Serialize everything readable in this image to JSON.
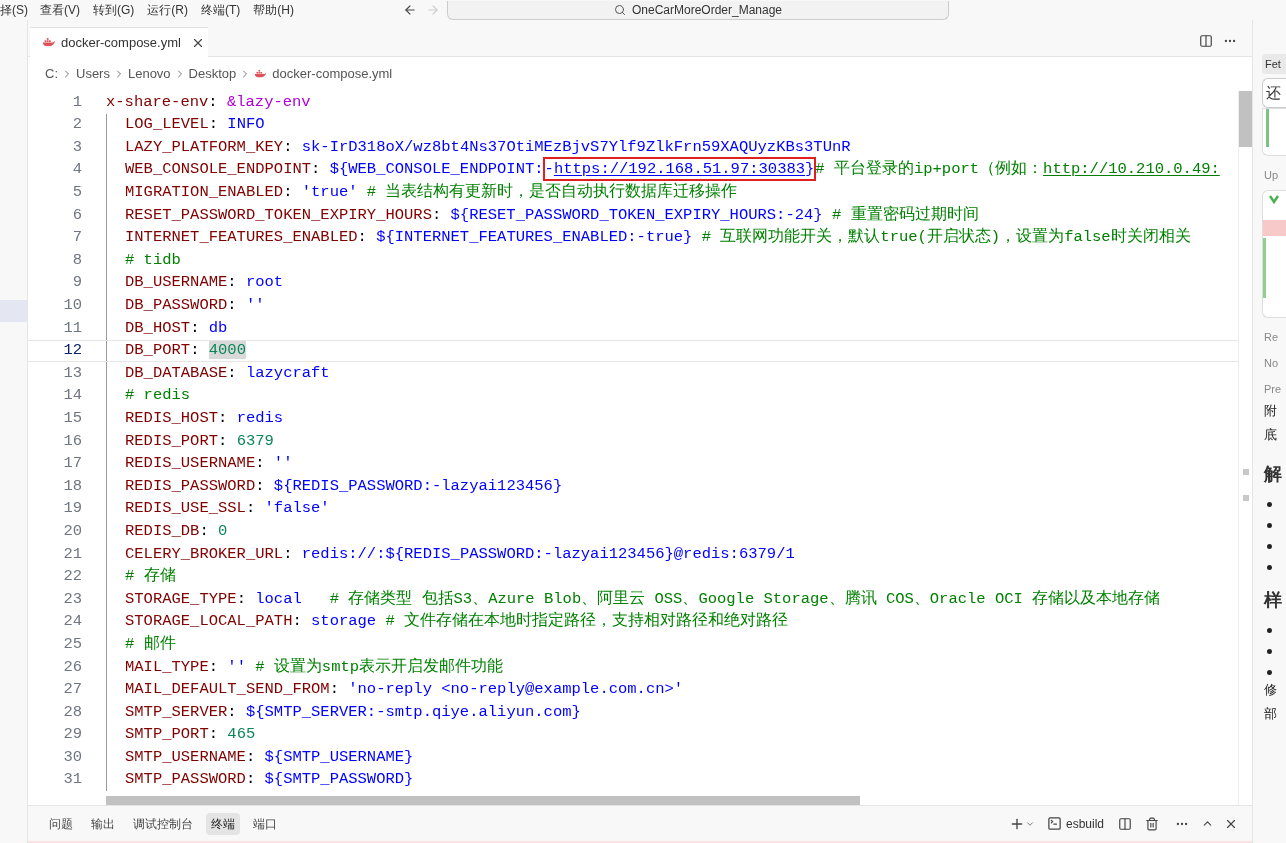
{
  "menu_bar": {
    "items": [
      "择(S)",
      "查看(V)",
      "转到(G)",
      "运行(R)",
      "终端(T)",
      "帮助(H)"
    ]
  },
  "command_center": {
    "search": "OneCarMoreOrder_Manage",
    "forward_disabled": true
  },
  "editor": {
    "tabs": [
      {
        "label": "docker-compose.yml",
        "selected": true
      }
    ],
    "breadcrumb": [
      "C:",
      "Users",
      "Lenovo",
      "Desktop",
      "docker-compose.yml"
    ],
    "lines": [
      {
        "number": "1",
        "current": false,
        "tokens": [
          {
            "kind": "key",
            "text": "x-share-env"
          },
          {
            "kind": "punct",
            "text": ": "
          },
          {
            "kind": "anchor",
            "text": "&lazy-env"
          }
        ],
        "children": [
          {
            "number": "2",
            "current": false,
            "tokens": [
              {
                "kind": "key",
                "text": "LOG_LEVEL"
              },
              {
                "kind": "punct",
                "text": ": "
              },
              {
                "kind": "value",
                "text": "INFO"
              }
            ]
          },
          {
            "number": "3",
            "current": false,
            "tokens": [
              {
                "kind": "key",
                "text": "LAZY_PLATFORM_KEY"
              },
              {
                "kind": "punct",
                "text": ": "
              },
              {
                "kind": "value",
                "text": "sk-IrD318oX/wz8bt4Ns37OtiMEzBjvS7Ylf9ZlkFrn59XAQUyzKBs3TUnR"
              }
            ]
          },
          {
            "number": "4",
            "current": false,
            "tokens": [
              {
                "kind": "key",
                "text": "WEB_CONSOLE_ENDPOINT"
              },
              {
                "kind": "punct",
                "text": ": "
              },
              {
                "kind": "value",
                "text": "${WEB_CONSOLE_ENDPOINT:"
              },
              {
                "kind": "boxed",
                "parts": [
                  {
                    "kind": "value",
                    "text": "-"
                  },
                  {
                    "kind": "link",
                    "text": "https://192.168.51.97:30383"
                  },
                  {
                    "kind": "value",
                    "text": "}"
                  }
                ]
              },
              {
                "kind": "comment",
                "text": "# 平台登录的ip+port（例如："
              },
              {
                "kind": "comment_link",
                "text": "http://10.210.0.49:"
              }
            ]
          },
          {
            "number": "5",
            "current": false,
            "tokens": [
              {
                "kind": "key",
                "text": "MIGRATION_ENABLED"
              },
              {
                "kind": "punct",
                "text": ": "
              },
              {
                "kind": "value",
                "text": "'true'"
              },
              {
                "kind": "comment",
                "text": " # 当表结构有更新时，是否自动执行数据库迁移操作"
              }
            ]
          },
          {
            "number": "6",
            "current": false,
            "tokens": [
              {
                "kind": "key",
                "text": "RESET_PASSWORD_TOKEN_EXPIRY_HOURS"
              },
              {
                "kind": "punct",
                "text": ": "
              },
              {
                "kind": "value",
                "text": "${RESET_PASSWORD_TOKEN_EXPIRY_HOURS:-24}"
              },
              {
                "kind": "comment",
                "text": " # 重置密码过期时间"
              }
            ]
          },
          {
            "number": "7",
            "current": false,
            "tokens": [
              {
                "kind": "key",
                "text": "INTERNET_FEATURES_ENABLED"
              },
              {
                "kind": "punct",
                "text": ": "
              },
              {
                "kind": "value",
                "text": "${INTERNET_FEATURES_ENABLED:-true}"
              },
              {
                "kind": "comment",
                "text": " # 互联网功能开关，默认true(开启状态)，设置为false时关闭相关"
              }
            ]
          },
          {
            "number": "8",
            "current": false,
            "tokens": [
              {
                "kind": "comment",
                "text": "# tidb"
              }
            ]
          },
          {
            "number": "9",
            "current": false,
            "tokens": [
              {
                "kind": "key",
                "text": "DB_USERNAME"
              },
              {
                "kind": "punct",
                "text": ": "
              },
              {
                "kind": "value",
                "text": "root"
              }
            ]
          },
          {
            "number": "10",
            "current": false,
            "tokens": [
              {
                "kind": "key",
                "text": "DB_PASSWORD"
              },
              {
                "kind": "punct",
                "text": ": "
              },
              {
                "kind": "value",
                "text": "''"
              }
            ]
          },
          {
            "number": "11",
            "current": false,
            "tokens": [
              {
                "kind": "key",
                "text": "DB_HOST"
              },
              {
                "kind": "punct",
                "text": ": "
              },
              {
                "kind": "value",
                "text": "db"
              }
            ]
          },
          {
            "number": "12",
            "current": true,
            "tokens": [
              {
                "kind": "key",
                "text": "DB_PORT"
              },
              {
                "kind": "punct",
                "text": ": "
              },
              {
                "kind": "match",
                "text": "4000"
              }
            ]
          },
          {
            "number": "13",
            "current": false,
            "tokens": [
              {
                "kind": "key",
                "text": "DB_DATABASE"
              },
              {
                "kind": "punct",
                "text": ": "
              },
              {
                "kind": "value",
                "text": "lazycraft"
              }
            ]
          },
          {
            "number": "14",
            "current": false,
            "tokens": [
              {
                "kind": "comment",
                "text": "# redis"
              }
            ]
          },
          {
            "number": "15",
            "current": false,
            "tokens": [
              {
                "kind": "key",
                "text": "REDIS_HOST"
              },
              {
                "kind": "punct",
                "text": ": "
              },
              {
                "kind": "value",
                "text": "redis"
              }
            ]
          },
          {
            "number": "16",
            "current": false,
            "tokens": [
              {
                "kind": "key",
                "text": "REDIS_PORT"
              },
              {
                "kind": "punct",
                "text": ": "
              },
              {
                "kind": "number",
                "text": "6379"
              }
            ]
          },
          {
            "number": "17",
            "current": false,
            "tokens": [
              {
                "kind": "key",
                "text": "REDIS_USERNAME"
              },
              {
                "kind": "punct",
                "text": ": "
              },
              {
                "kind": "value",
                "text": "''"
              }
            ]
          },
          {
            "number": "18",
            "current": false,
            "tokens": [
              {
                "kind": "key",
                "text": "REDIS_PASSWORD"
              },
              {
                "kind": "punct",
                "text": ": "
              },
              {
                "kind": "value",
                "text": "${REDIS_PASSWORD:-lazyai123456}"
              }
            ]
          },
          {
            "number": "19",
            "current": false,
            "tokens": [
              {
                "kind": "key",
                "text": "REDIS_USE_SSL"
              },
              {
                "kind": "punct",
                "text": ": "
              },
              {
                "kind": "value",
                "text": "'false'"
              }
            ]
          },
          {
            "number": "20",
            "current": false,
            "tokens": [
              {
                "kind": "key",
                "text": "REDIS_DB"
              },
              {
                "kind": "punct",
                "text": ": "
              },
              {
                "kind": "number",
                "text": "0"
              }
            ]
          },
          {
            "number": "21",
            "current": false,
            "tokens": [
              {
                "kind": "key",
                "text": "CELERY_BROKER_URL"
              },
              {
                "kind": "punct",
                "text": ": "
              },
              {
                "kind": "value",
                "text": "redis://:${REDIS_PASSWORD:-lazyai123456}@redis:6379/1"
              }
            ]
          },
          {
            "number": "22",
            "current": false,
            "tokens": [
              {
                "kind": "comment",
                "text": "# 存储"
              }
            ]
          },
          {
            "number": "23",
            "current": false,
            "tokens": [
              {
                "kind": "key",
                "text": "STORAGE_TYPE"
              },
              {
                "kind": "punct",
                "text": ": "
              },
              {
                "kind": "value",
                "text": "local"
              },
              {
                "kind": "comment",
                "text": "   # 存储类型 包括S3、Azure Blob、阿里云 OSS、Google Storage、腾讯 COS、Oracle OCI 存储以及本地存储"
              }
            ]
          },
          {
            "number": "24",
            "current": false,
            "tokens": [
              {
                "kind": "key",
                "text": "STORAGE_LOCAL_PATH"
              },
              {
                "kind": "punct",
                "text": ": "
              },
              {
                "kind": "value",
                "text": "storage"
              },
              {
                "kind": "comment",
                "text": " # 文件存储在本地时指定路径，支持相对路径和绝对路径"
              }
            ]
          },
          {
            "number": "25",
            "current": false,
            "tokens": [
              {
                "kind": "comment",
                "text": "# 邮件"
              }
            ]
          },
          {
            "number": "26",
            "current": false,
            "tokens": [
              {
                "kind": "key",
                "text": "MAIL_TYPE"
              },
              {
                "kind": "punct",
                "text": ": "
              },
              {
                "kind": "value",
                "text": "''"
              },
              {
                "kind": "comment",
                "text": " # 设置为smtp表示开启发邮件功能"
              }
            ]
          },
          {
            "number": "27",
            "current": false,
            "tokens": [
              {
                "kind": "key",
                "text": "MAIL_DEFAULT_SEND_FROM"
              },
              {
                "kind": "punct",
                "text": ": "
              },
              {
                "kind": "value",
                "text": "'no-reply <no-reply@example.com.cn>'"
              }
            ]
          },
          {
            "number": "28",
            "current": false,
            "tokens": [
              {
                "kind": "key",
                "text": "SMTP_SERVER"
              },
              {
                "kind": "punct",
                "text": ": "
              },
              {
                "kind": "value",
                "text": "${SMTP_SERVER:-smtp.qiye.aliyun.com}"
              }
            ]
          },
          {
            "number": "29",
            "current": false,
            "tokens": [
              {
                "kind": "key",
                "text": "SMTP_PORT"
              },
              {
                "kind": "punct",
                "text": ": "
              },
              {
                "kind": "number",
                "text": "465"
              }
            ]
          },
          {
            "number": "30",
            "current": false,
            "tokens": [
              {
                "kind": "key",
                "text": "SMTP_USERNAME"
              },
              {
                "kind": "punct",
                "text": ": "
              },
              {
                "kind": "value",
                "text": "${SMTP_USERNAME}"
              }
            ]
          },
          {
            "number": "31",
            "current": false,
            "tokens": [
              {
                "kind": "key",
                "text": "SMTP_PASSWORD"
              },
              {
                "kind": "punct",
                "text": ": "
              },
              {
                "kind": "value",
                "text": "${SMTP_PASSWORD}"
              }
            ]
          }
        ]
      }
    ]
  },
  "panel": {
    "tabs": [
      {
        "label": "问题",
        "selected": false
      },
      {
        "label": "输出",
        "selected": false
      },
      {
        "label": "调试控制台",
        "selected": false
      },
      {
        "label": "终端",
        "selected": true
      },
      {
        "label": "端口",
        "selected": false
      }
    ],
    "terminal_name": "esbuild"
  },
  "side_panel": {
    "items": [
      {
        "kind": "chip",
        "text": "Fet"
      },
      {
        "kind": "box",
        "text": "还"
      },
      {
        "kind": "card_end"
      },
      {
        "kind": "label",
        "text": "Up"
      },
      {
        "kind": "card"
      },
      {
        "kind": "label",
        "text": "Re"
      },
      {
        "kind": "label",
        "text": "No"
      },
      {
        "kind": "label",
        "text": "Pre"
      },
      {
        "kind": "text",
        "text": "附"
      },
      {
        "kind": "text",
        "text": "底"
      },
      {
        "kind": "heading",
        "text": "解"
      },
      {
        "kind": "bullet"
      },
      {
        "kind": "bullet"
      },
      {
        "kind": "bullet"
      },
      {
        "kind": "bullet"
      },
      {
        "kind": "heading",
        "text": "样"
      },
      {
        "kind": "bullet"
      },
      {
        "kind": "bullet"
      },
      {
        "kind": "bullet"
      },
      {
        "kind": "text",
        "text": "修"
      },
      {
        "kind": "text",
        "text": "部"
      }
    ]
  }
}
